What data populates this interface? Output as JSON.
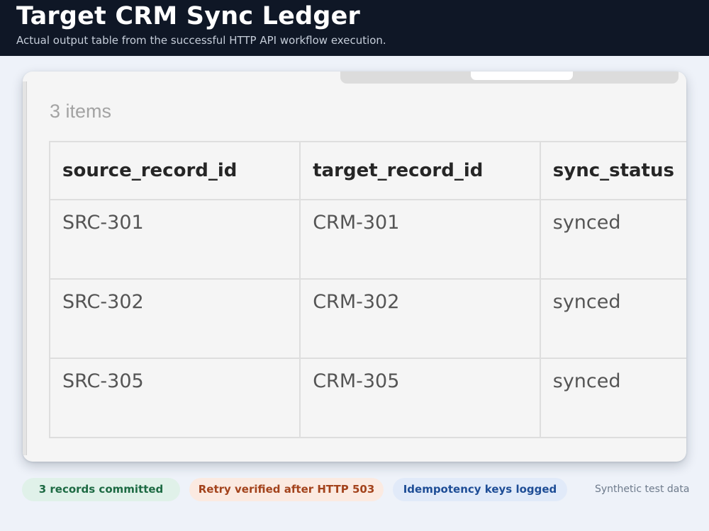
{
  "header": {
    "title": "Target CRM Sync Ledger",
    "subtitle": "Actual output table from the successful HTTP API workflow execution."
  },
  "results": {
    "items_count": "3 items",
    "columns": [
      "source_record_id",
      "target_record_id",
      "sync_status"
    ],
    "rows": [
      [
        "SRC-301",
        "CRM-301",
        "synced"
      ],
      [
        "SRC-302",
        "CRM-302",
        "synced"
      ],
      [
        "SRC-305",
        "CRM-305",
        "synced"
      ]
    ]
  },
  "footer": {
    "badges": [
      {
        "label": "3 records committed",
        "color": "#1d6a43",
        "background": "#e0f1e9"
      },
      {
        "label": "Retry verified after HTTP 503",
        "color": "#a3431c",
        "background": "#fbeae1"
      },
      {
        "label": "Idempotency keys logged",
        "color": "#1e4d96",
        "background": "#e1eaf9"
      }
    ],
    "note": "Synthetic test data"
  },
  "colors": {
    "header_bg": "#0f1726",
    "page_bg": "#eef2f9",
    "card_bg": "#f5f5f5"
  }
}
